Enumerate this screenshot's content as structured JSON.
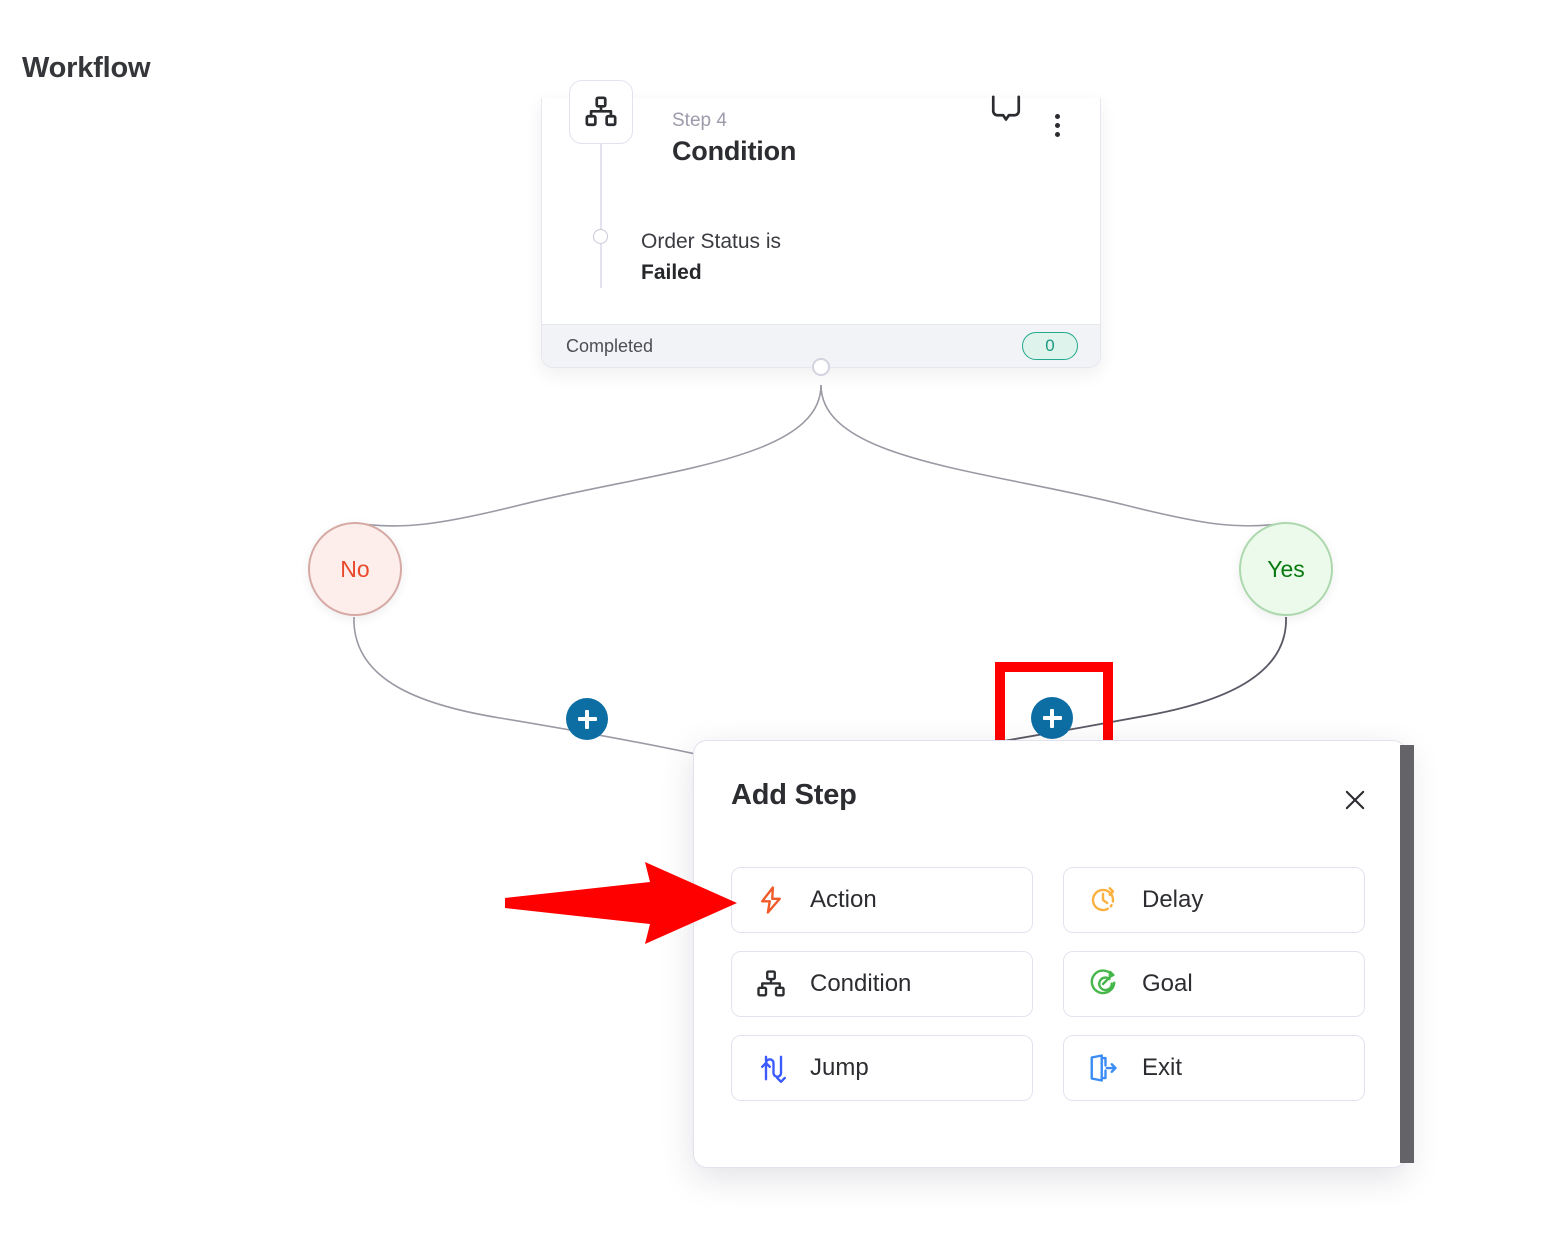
{
  "page": {
    "title": "Workflow"
  },
  "step_card": {
    "step_label": "Step 4",
    "title": "Condition",
    "condition_prefix": "Order Status is",
    "condition_value": "Failed",
    "status_label": "Completed",
    "status_count": "0",
    "icon": "sitemap-icon",
    "comment_icon": "comment-icon",
    "menu_icon": "more-vertical-icon",
    "accent": "#23a98d"
  },
  "branches": [
    {
      "label": "No",
      "name": "branch-node-no",
      "color": "#e8492a",
      "fill": "#fdeeec",
      "border": "#d6a9a4"
    },
    {
      "label": "Yes",
      "name": "branch-node-yes",
      "color": "#0a7a10",
      "fill": "#ebfaeb",
      "border": "#add8ad"
    }
  ],
  "add_buttons": {
    "left_name": "add-step-plus-no-branch",
    "right_name": "add-step-plus-yes-branch",
    "color": "#0d6ea4"
  },
  "annotations": {
    "highlight_box_color": "#fe0000",
    "arrow_color": "#fe0000",
    "arrow_target": "Action"
  },
  "add_step_panel": {
    "title": "Add Step",
    "close_icon": "close-icon",
    "options": [
      {
        "label": "Action",
        "icon": "lightning-bolt-icon",
        "color": "#f15a29"
      },
      {
        "label": "Delay",
        "icon": "clock-dashed-icon",
        "color": "#fbb040"
      },
      {
        "label": "Condition",
        "icon": "sitemap-icon",
        "color": "#2c2d31"
      },
      {
        "label": "Goal",
        "icon": "target-dart-icon",
        "color": "#45b649"
      },
      {
        "label": "Jump",
        "icon": "jump-arrows-icon",
        "color": "#3b5bfd"
      },
      {
        "label": "Exit",
        "icon": "door-exit-icon",
        "color": "#3b8cf5"
      }
    ]
  }
}
